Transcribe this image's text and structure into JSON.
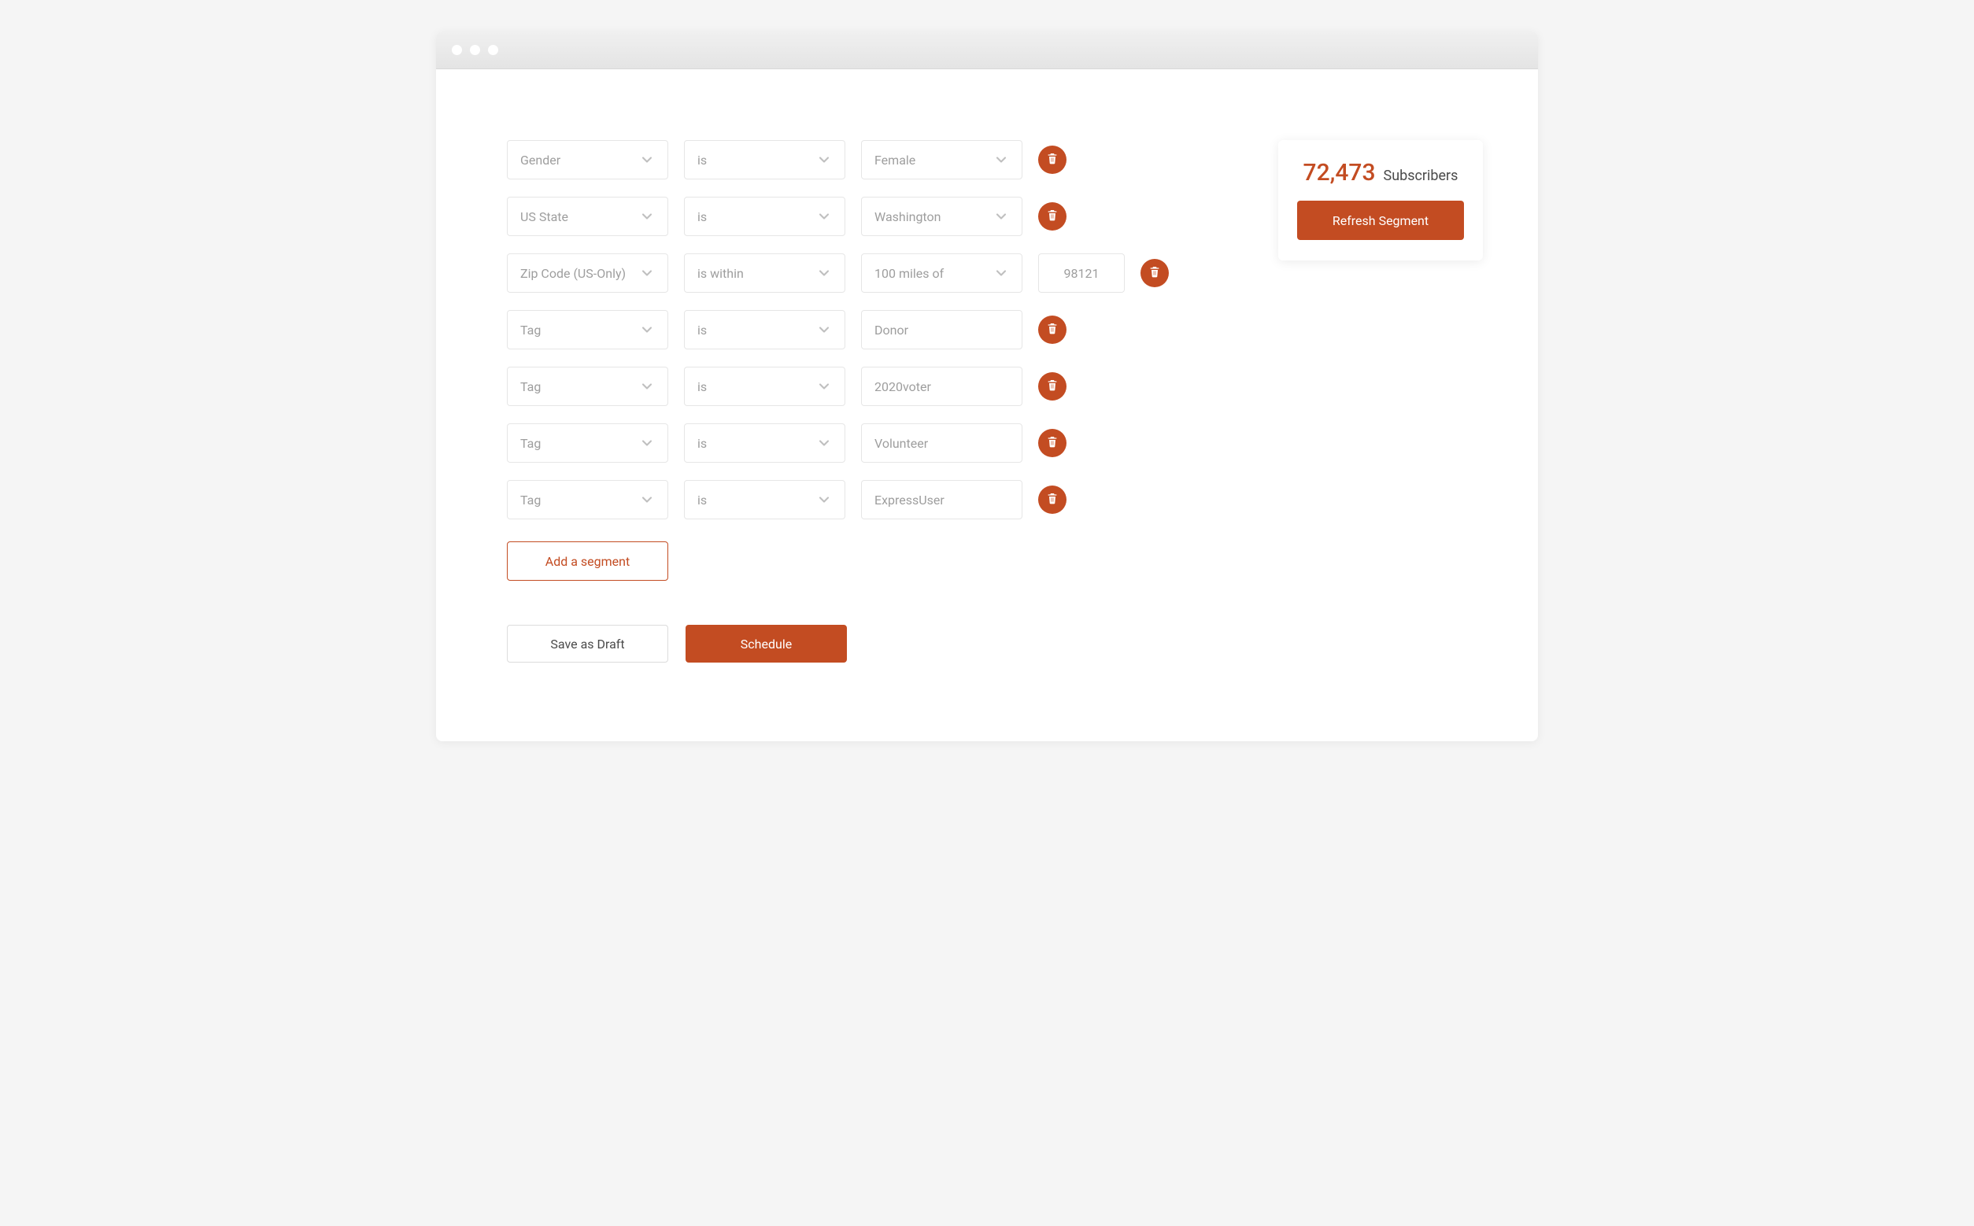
{
  "filters": [
    {
      "field": "Gender",
      "operator": "is",
      "value": "Female",
      "has_value_dropdown": true
    },
    {
      "field": "US State",
      "operator": "is",
      "value": "Washington",
      "has_value_dropdown": true
    },
    {
      "field": "Zip Code (US-Only)",
      "operator": "is within",
      "value": "100 miles of",
      "has_value_dropdown": true,
      "extra_input": "98121"
    },
    {
      "field": "Tag",
      "operator": "is",
      "value": "Donor",
      "has_value_dropdown": false
    },
    {
      "field": "Tag",
      "operator": "is",
      "value": "2020voter",
      "has_value_dropdown": false
    },
    {
      "field": "Tag",
      "operator": "is",
      "value": "Volunteer",
      "has_value_dropdown": false
    },
    {
      "field": "Tag",
      "operator": "is",
      "value": "ExpressUser",
      "has_value_dropdown": false
    }
  ],
  "buttons": {
    "add_segment": "Add a segment",
    "save_draft": "Save as Draft",
    "schedule": "Schedule",
    "refresh": "Refresh Segment"
  },
  "sidebar": {
    "subscriber_count": "72,473",
    "subscriber_label": "Subscribers"
  }
}
